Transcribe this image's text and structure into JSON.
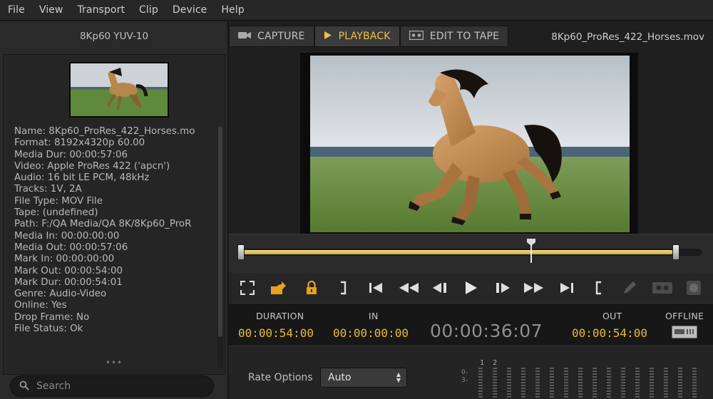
{
  "menu": [
    "File",
    "View",
    "Transport",
    "Clip",
    "Device",
    "Help"
  ],
  "left": {
    "format_label": "8Kp60  YUV-10",
    "info": [
      {
        "k": "Name:",
        "v": "8Kp60_ProRes_422_Horses.mo"
      },
      {
        "k": "Format:",
        "v": "8192x4320p 60.00"
      },
      {
        "k": "Media Dur:",
        "v": "00:00:57:06"
      },
      {
        "k": "Video:",
        "v": "Apple ProRes 422 ('apcn')"
      },
      {
        "k": "Audio:",
        "v": "16 bit LE PCM, 48kHz"
      },
      {
        "k": "Tracks:",
        "v": "1V, 2A"
      },
      {
        "k": "File Type:",
        "v": "MOV File"
      },
      {
        "k": "Tape:",
        "v": "(undefined)"
      },
      {
        "k": "Path:",
        "v": "F:/QA Media/QA 8K/8Kp60_ProR"
      },
      {
        "k": "Media In:",
        "v": "00:00:00:00"
      },
      {
        "k": "Media Out:",
        "v": "00:00:57:06"
      },
      {
        "k": "Mark In:",
        "v": "00:00:00:00"
      },
      {
        "k": "Mark Out:",
        "v": "00:00:54:00"
      },
      {
        "k": "Mark Dur:",
        "v": "00:00:54:01"
      },
      {
        "k": "Genre:",
        "v": "Audio-Video"
      },
      {
        "k": "Online:",
        "v": "Yes"
      },
      {
        "k": "Drop Frame:",
        "v": "No"
      },
      {
        "k": "File Status:",
        "v": "Ok"
      }
    ],
    "grip": "•••",
    "search_placeholder": "Search"
  },
  "tabs": [
    {
      "label": "CAPTURE",
      "icon": "camera-icon",
      "active": false
    },
    {
      "label": "PLAYBACK",
      "icon": "play-icon",
      "active": true
    },
    {
      "label": "EDIT TO TAPE",
      "icon": "tape-icon",
      "active": false
    }
  ],
  "filename": "8Kp60_ProRes_422_Horses.mov",
  "timeline": {
    "playhead_fraction": 0.68,
    "mark_in_fraction": 0.0,
    "mark_out_fraction": 0.94
  },
  "timecodes": {
    "duration_label": "DURATION",
    "duration": "00:00:54:00",
    "in_label": "IN",
    "in": "00:00:00:00",
    "current": "00:00:36:07",
    "out_label": "OUT",
    "out": "00:00:54:00",
    "offline_label": "OFFLINE"
  },
  "rate": {
    "label": "Rate Options",
    "value": "Auto"
  },
  "meters": {
    "channels": [
      "1",
      "2"
    ],
    "scale": [
      "0-",
      "3-"
    ]
  },
  "colors": {
    "accent": "#f0c040",
    "timecode": "#e6bb3c",
    "lock": "#e8a020"
  }
}
